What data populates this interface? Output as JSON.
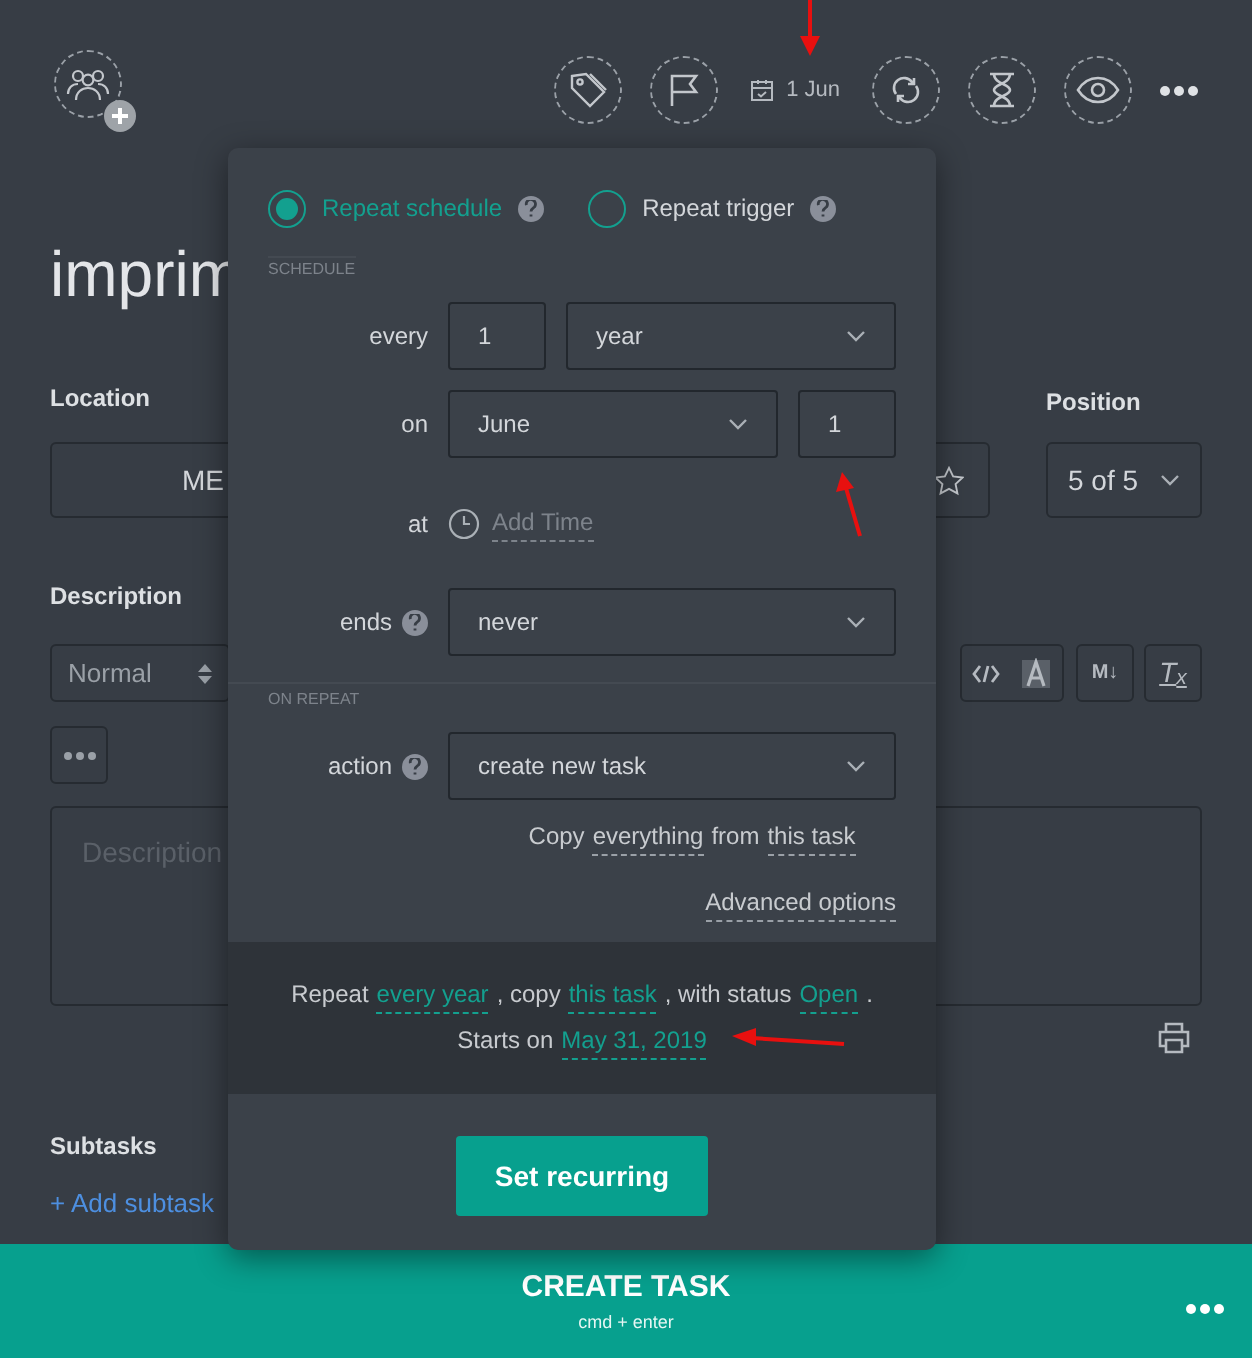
{
  "toolbar": {
    "date": "1 Jun"
  },
  "task": {
    "title": "imprim",
    "location": {
      "label": "Location",
      "value": "ME"
    },
    "position": {
      "label": "Position",
      "value": "5 of 5"
    },
    "description": {
      "label": "Description",
      "format": "Normal",
      "markdown": "M↓",
      "clear": "T$_{x}$",
      "placeholder": "Description"
    },
    "subtasks": {
      "label": "Subtasks",
      "add": "+ Add subtask"
    }
  },
  "recurrence": {
    "modes": [
      {
        "label": "Repeat schedule",
        "selected": true
      },
      {
        "label": "Repeat trigger",
        "selected": false
      }
    ],
    "schedule_heading": "SCHEDULE",
    "every": {
      "label": "every",
      "count": "1",
      "unit": "year"
    },
    "on": {
      "label": "on",
      "month": "June",
      "day": "1"
    },
    "at": {
      "label": "at",
      "placeholder": "Add Time"
    },
    "ends": {
      "label": "ends",
      "value": "never"
    },
    "on_repeat_heading": "ON REPEAT",
    "action": {
      "label": "action",
      "value": "create new task"
    },
    "copy_note": [
      {
        "kind": "plain",
        "text": "Copy"
      },
      {
        "kind": "link",
        "text": "everything"
      },
      {
        "kind": "plain",
        "text": "from"
      },
      {
        "kind": "link",
        "text": "this task"
      }
    ],
    "advanced": "Advanced options",
    "summary": [
      [
        {
          "kind": "plain",
          "text": "Repeat"
        },
        {
          "kind": "accent",
          "text": "every year"
        },
        {
          "kind": "plain",
          "text": ", copy"
        },
        {
          "kind": "accent",
          "text": "this task"
        },
        {
          "kind": "plain",
          "text": ", with status"
        },
        {
          "kind": "accent",
          "text": "Open"
        },
        {
          "kind": "plain",
          "text": "."
        }
      ],
      [
        {
          "kind": "plain",
          "text": "Starts on"
        },
        {
          "kind": "accent",
          "text": "May 31, 2019"
        }
      ]
    ],
    "submit": "Set recurring"
  },
  "footer": {
    "title": "CREATE TASK",
    "hint": "cmd + enter"
  }
}
